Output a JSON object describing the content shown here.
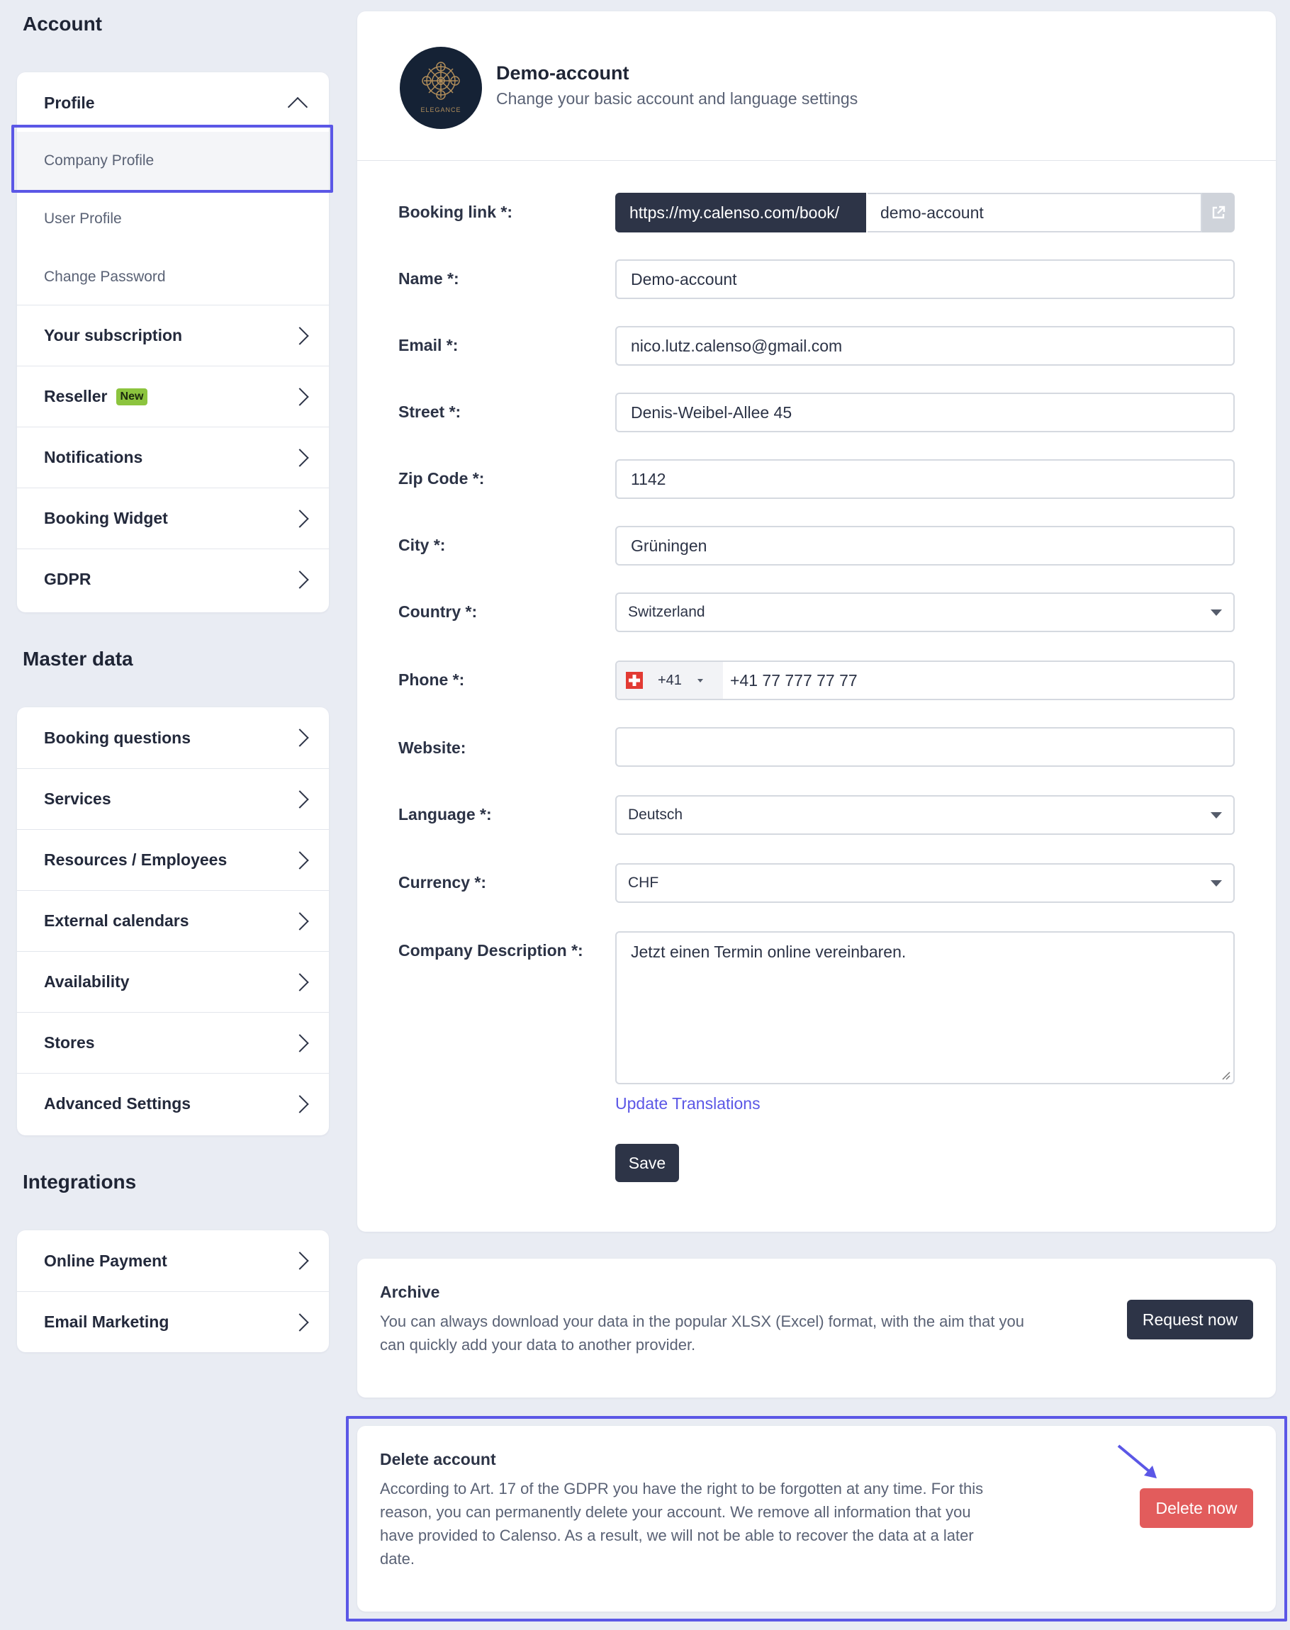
{
  "sidebar": {
    "account_title": "Account",
    "profile": {
      "label": "Profile",
      "subitems": [
        "Company Profile",
        "User Profile",
        "Change Password"
      ]
    },
    "account_items": [
      {
        "label": "Your subscription"
      },
      {
        "label": "Reseller",
        "badge": "New"
      },
      {
        "label": "Notifications"
      },
      {
        "label": "Booking Widget"
      },
      {
        "label": "GDPR"
      }
    ],
    "master_title": "Master data",
    "master_items": [
      "Booking questions",
      "Services",
      "Resources / Employees",
      "External calendars",
      "Availability",
      "Stores",
      "Advanced Settings"
    ],
    "integrations_title": "Integrations",
    "integration_items": [
      "Online Payment",
      "Email Marketing"
    ]
  },
  "header": {
    "logo_text": "ELEGANCE",
    "account_name": "Demo-account",
    "subtitle": "Change your basic account and language settings"
  },
  "form": {
    "booking_link": {
      "label": "Booking link *:",
      "prefix": "https://my.calenso.com/book/",
      "value": "demo-account",
      "icon": "external-link-icon"
    },
    "name": {
      "label": "Name *:",
      "value": "Demo-account"
    },
    "email": {
      "label": "Email *:",
      "value": "nico.lutz.calenso@gmail.com"
    },
    "street": {
      "label": "Street *:",
      "value": "Denis-Weibel-Allee 45"
    },
    "zip": {
      "label": "Zip Code *:",
      "value": "1142"
    },
    "city": {
      "label": "City *:",
      "value": "Grüningen"
    },
    "country": {
      "label": "Country *:",
      "value": "Switzerland"
    },
    "phone": {
      "label": "Phone *:",
      "dial_code": "+41",
      "value": "+41 77 777 77 77",
      "flag": "swiss-flag-icon"
    },
    "website": {
      "label": "Website:",
      "value": ""
    },
    "language": {
      "label": "Language *:",
      "value": "Deutsch"
    },
    "currency": {
      "label": "Currency *:",
      "value": "CHF"
    },
    "description": {
      "label": "Company Description *:",
      "value": "Jetzt einen Termin online vereinbaren."
    },
    "update_translations": "Update Translations",
    "save_label": "Save"
  },
  "archive": {
    "title": "Archive",
    "text_line1": "You can always download your data in the popular XLSX (Excel) format, with the aim that you",
    "text_line2": "can quickly add your data to another provider.",
    "button": "Request now"
  },
  "delete": {
    "title": "Delete account",
    "text_line1": "According to Art. 17 of the GDPR you have the right to be forgotten at any time. For this",
    "text_line2": "reason, you can permanently delete your account. We remove all information that you",
    "text_line3": "have provided to Calenso. As a result, we will not be able to recover the data at a later",
    "text_line4": "date.",
    "button": "Delete now"
  },
  "colors": {
    "accent": "#5b57e6",
    "dark_button": "#2d3447",
    "danger": "#e25c5c",
    "badge": "#8cc43e"
  }
}
